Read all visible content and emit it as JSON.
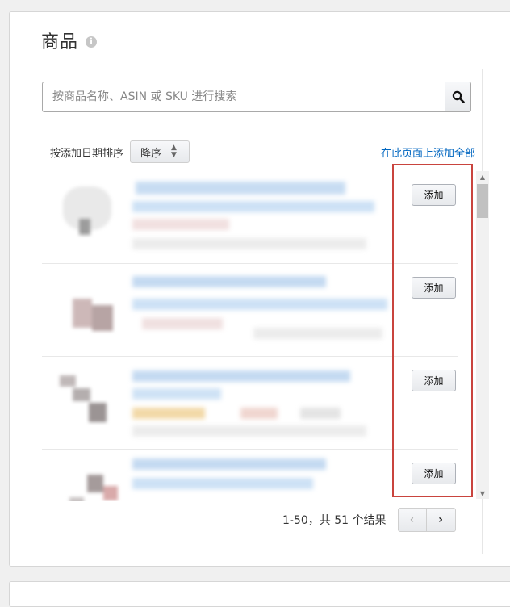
{
  "panel": {
    "title": "商品"
  },
  "search": {
    "placeholder": "按商品名称、ASIN 或 SKU 进行搜索"
  },
  "sort": {
    "label": "按添加日期排序",
    "selected": "降序",
    "add_all": "在此页面上添加全部"
  },
  "products": [
    {
      "add_label": "添加"
    },
    {
      "add_label": "添加"
    },
    {
      "add_label": "添加"
    },
    {
      "add_label": "添加"
    }
  ],
  "pagination": {
    "summary": "1-50，共 51 个结果"
  },
  "colors": {
    "link": "#0066c0",
    "highlight": "#c9443e"
  }
}
